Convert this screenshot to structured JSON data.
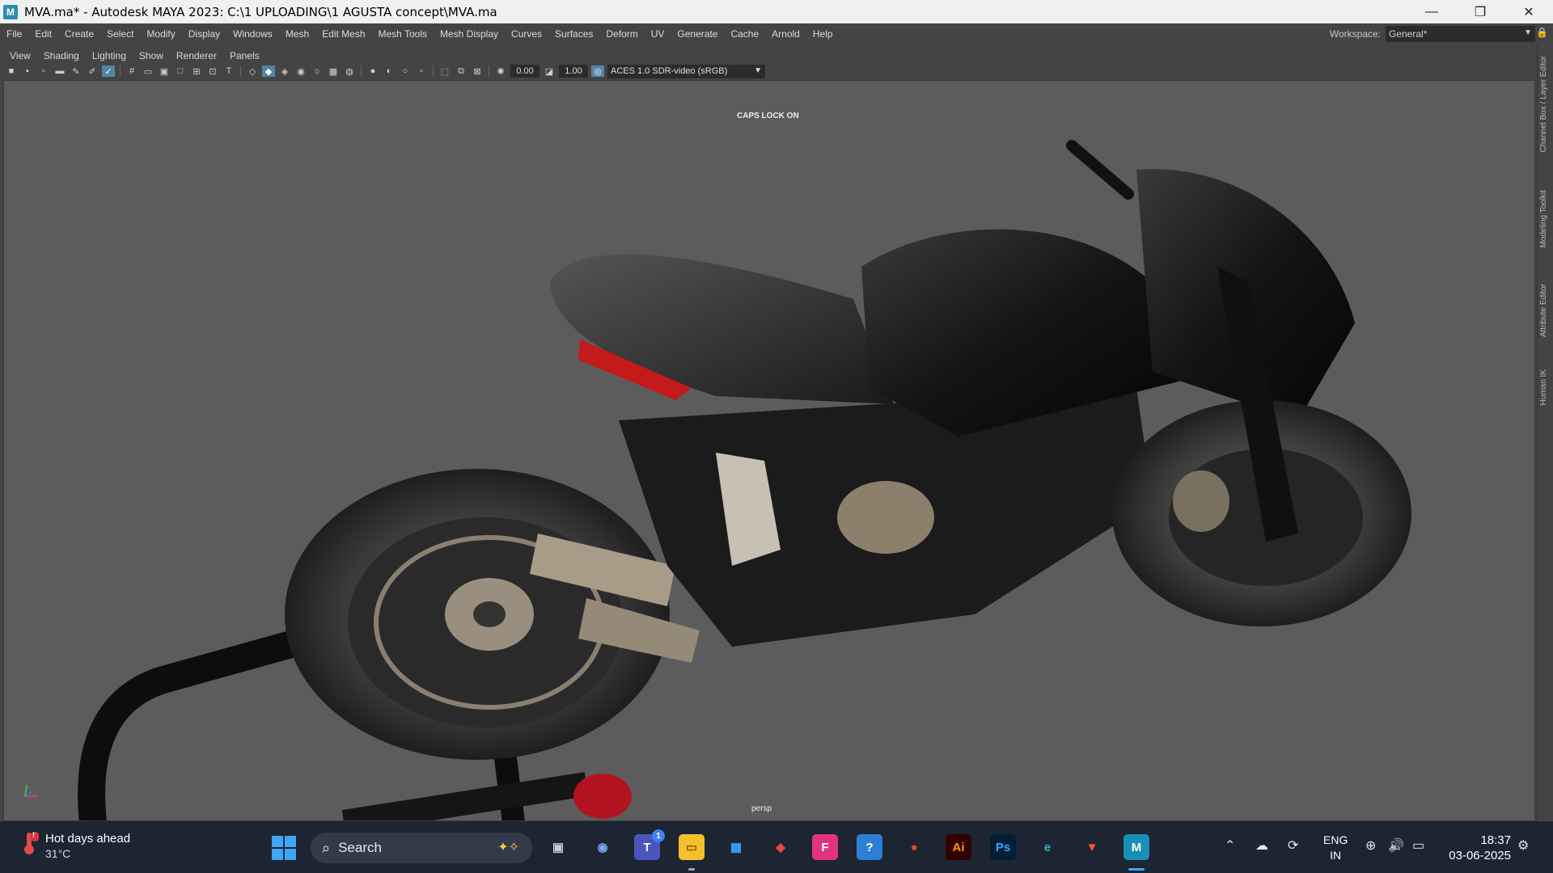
{
  "window": {
    "title": "MVA.ma* - Autodesk MAYA 2023: C:\\1 UPLOADING\\1 AGUSTA concept\\MVA.ma",
    "app_icon_letter": "M",
    "controls": {
      "minimize": "—",
      "restore": "❐",
      "close": "✕"
    }
  },
  "menubar": {
    "items": [
      "File",
      "Edit",
      "Create",
      "Select",
      "Modify",
      "Display",
      "Windows",
      "Mesh",
      "Edit Mesh",
      "Mesh Tools",
      "Mesh Display",
      "Curves",
      "Surfaces",
      "Deform",
      "UV",
      "Generate",
      "Cache",
      "Arnold",
      "Help"
    ],
    "workspace_label": "Workspace:",
    "workspace_value": "General*"
  },
  "panel_menu": {
    "items": [
      "View",
      "Shading",
      "Lighting",
      "Show",
      "Renderer",
      "Panels"
    ]
  },
  "panel_toolbar": {
    "exposure_value": "0.00",
    "gamma_value": "1.00",
    "color_management": "ACES 1.0 SDR-video (sRGB)"
  },
  "viewport": {
    "hud_message": "CAPS LOCK ON",
    "camera_label": "persp"
  },
  "side_tabs": [
    "Channel Box / Layer Editor",
    "Modeling Toolkit",
    "Attribute Editor",
    "Human IK"
  ],
  "taskbar": {
    "weather_title": "Hot days ahead",
    "weather_temp": "31°C",
    "weather_alert": "!",
    "search_placeholder": "Search",
    "teams_badge": "1",
    "apps": [
      {
        "name": "task-view",
        "glyph": "▣",
        "bg": "#1d2432",
        "fg": "#c7ccd6"
      },
      {
        "name": "copilot",
        "glyph": "◉",
        "bg": "#1d2432",
        "fg": "#7aa5ff"
      },
      {
        "name": "teams",
        "glyph": "T",
        "bg": "#4b53bc",
        "fg": "#ffffff"
      },
      {
        "name": "file-explorer",
        "glyph": "▭",
        "bg": "#f3c12f",
        "fg": "#8a6100"
      },
      {
        "name": "microsoft-store",
        "glyph": "▦",
        "bg": "#1d2432",
        "fg": "#3ea7f5"
      },
      {
        "name": "anydesk",
        "glyph": "◆",
        "bg": "#1d2432",
        "fg": "#ef443b"
      },
      {
        "name": "forza",
        "glyph": "F",
        "bg": "#e0347d",
        "fg": "#ffffff"
      },
      {
        "name": "get-help",
        "glyph": "?",
        "bg": "#2d7fd6",
        "fg": "#ffffff"
      },
      {
        "name": "chrome",
        "glyph": "●",
        "bg": "#1d2432",
        "fg": "#ea4335"
      },
      {
        "name": "illustrator",
        "glyph": "Ai",
        "bg": "#330000",
        "fg": "#ff9a00"
      },
      {
        "name": "photoshop",
        "glyph": "Ps",
        "bg": "#001e36",
        "fg": "#31a8ff"
      },
      {
        "name": "edge",
        "glyph": "e",
        "bg": "#1d2432",
        "fg": "#2fb5c9"
      },
      {
        "name": "brave",
        "glyph": "▼",
        "bg": "#1d2432",
        "fg": "#fb542b"
      },
      {
        "name": "maya",
        "glyph": "M",
        "bg": "#1a8fb5",
        "fg": "#ffffff"
      }
    ],
    "lang_line1": "ENG",
    "lang_line2": "IN",
    "time": "18:37",
    "date": "03-06-2025"
  },
  "colors": {
    "maya_ui": "#444444",
    "viewport_bg": "#5c5c5c",
    "accent_blue": "#5285a6",
    "taskbar_bg": "#1d2432"
  }
}
